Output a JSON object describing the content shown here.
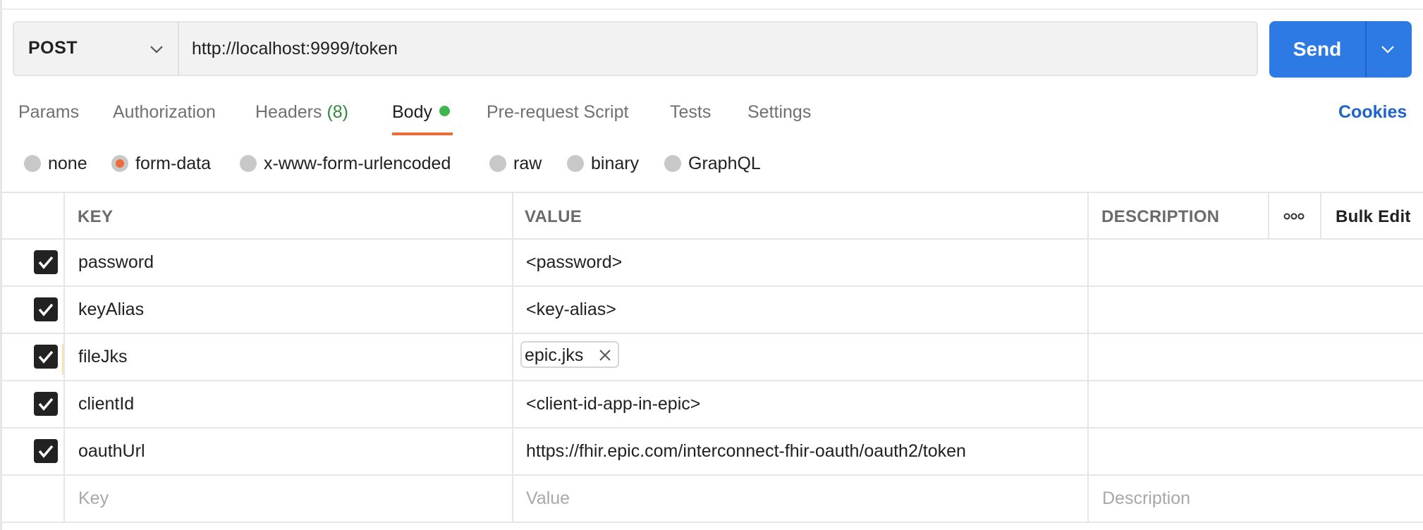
{
  "request": {
    "method": "POST",
    "url": "http://localhost:9999/token",
    "send_label": "Send"
  },
  "tabs": [
    {
      "label": "Params"
    },
    {
      "label": "Authorization"
    },
    {
      "label": "Headers",
      "count": "(8)"
    },
    {
      "label": "Body",
      "active": true
    },
    {
      "label": "Pre-request Script"
    },
    {
      "label": "Tests"
    },
    {
      "label": "Settings"
    }
  ],
  "cookies_label": "Cookies",
  "body_types": [
    {
      "label": "none"
    },
    {
      "label": "form-data",
      "selected": true
    },
    {
      "label": "x-www-form-urlencoded"
    },
    {
      "label": "raw"
    },
    {
      "label": "binary"
    },
    {
      "label": "GraphQL"
    }
  ],
  "table": {
    "headers": {
      "key": "KEY",
      "value": "VALUE",
      "description": "DESCRIPTION",
      "bulk_edit": "Bulk Edit"
    },
    "rows": [
      {
        "key": "password",
        "value": "<password>",
        "checked": true
      },
      {
        "key": "keyAlias",
        "value": "<key-alias>",
        "checked": true
      },
      {
        "key": "fileJks",
        "file": "epic.jks",
        "checked": true
      },
      {
        "key": "clientId",
        "value": "<client-id-app-in-epic>",
        "checked": true
      },
      {
        "key": "oauthUrl",
        "value": "https://fhir.epic.com/interconnect-fhir-oauth/oauth2/token",
        "checked": true
      }
    ],
    "placeholders": {
      "key": "Key",
      "value": "Value",
      "description": "Description"
    }
  },
  "colors": {
    "accent_orange": "#ef6c3a",
    "send_blue": "#2e7ae4",
    "cookies_blue": "#1e63c8",
    "body_dot_green": "#3fb550"
  },
  "icons": {
    "method_dropdown": "chevron-down-icon",
    "send_dropdown": "chevron-down-icon",
    "more": "more-horizontal-icon",
    "remove_file": "close-icon",
    "checkbox": "checkmark-icon"
  }
}
